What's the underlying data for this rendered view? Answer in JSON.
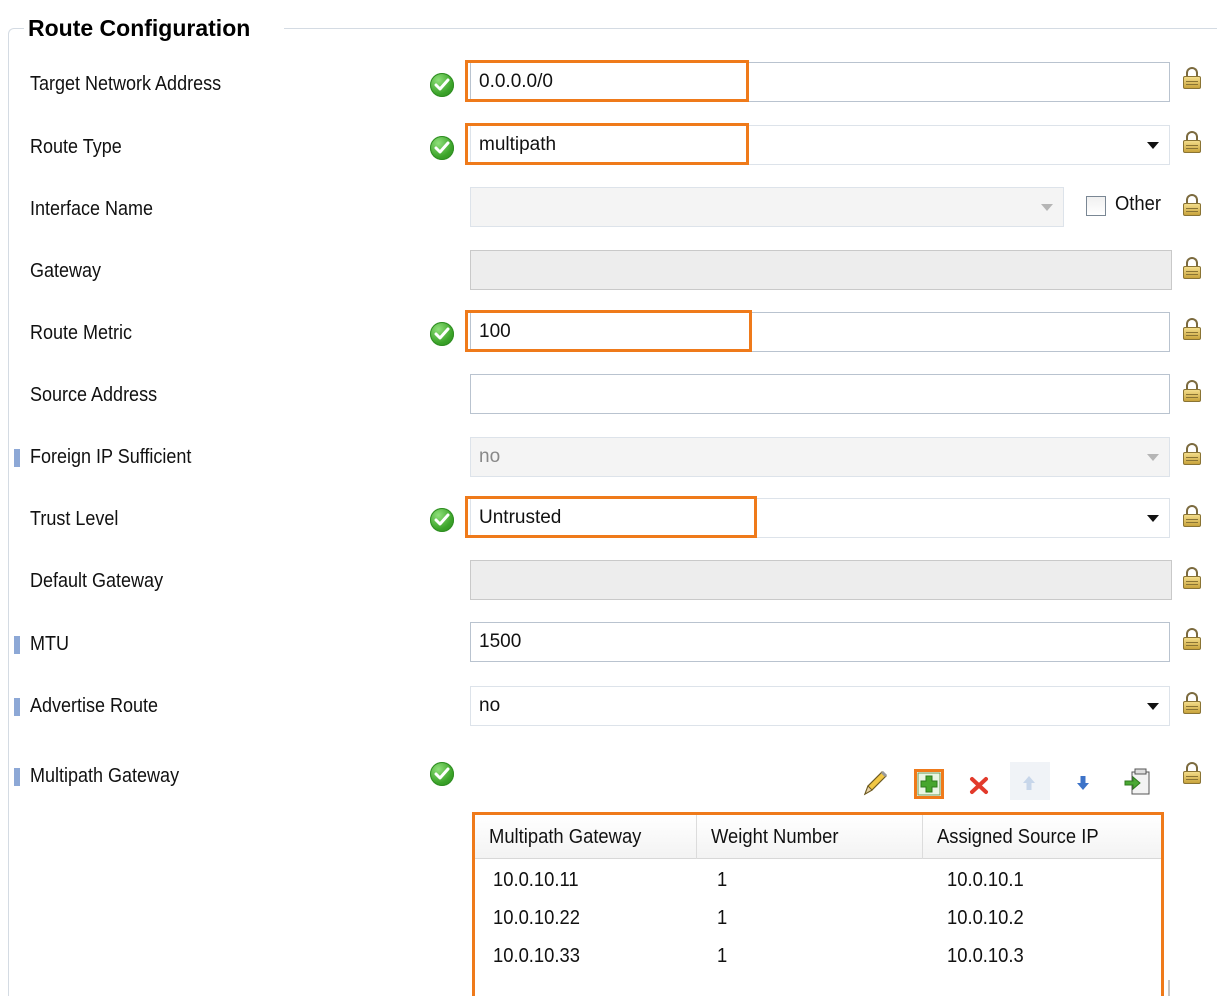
{
  "group": {
    "title": "Route Configuration"
  },
  "fields": {
    "target_network": {
      "label": "Target Network Address",
      "value": "0.0.0.0/0"
    },
    "route_type": {
      "label": "Route Type",
      "value": "multipath"
    },
    "interface_name": {
      "label": "Interface Name",
      "value": "",
      "other_label": "Other"
    },
    "gateway": {
      "label": "Gateway",
      "value": ""
    },
    "route_metric": {
      "label": "Route Metric",
      "value": "100"
    },
    "source_address": {
      "label": "Source Address",
      "value": ""
    },
    "foreign_ip": {
      "label": "Foreign IP Sufficient",
      "value": "no"
    },
    "trust_level": {
      "label": "Trust Level",
      "value": "Untrusted"
    },
    "default_gateway": {
      "label": "Default Gateway",
      "value": ""
    },
    "mtu": {
      "label": "MTU",
      "value": "1500"
    },
    "advertise_route": {
      "label": "Advertise Route",
      "value": "no"
    },
    "multipath_gateway": {
      "label": "Multipath Gateway"
    }
  },
  "toolbar": {
    "icons": [
      "edit-icon",
      "add-icon",
      "delete-icon",
      "move-up-icon",
      "move-down-icon",
      "import-icon"
    ]
  },
  "table": {
    "columns": [
      "Multipath Gateway",
      "Weight Number",
      "Assigned Source IP"
    ],
    "rows": [
      [
        "10.0.10.11",
        "1",
        "10.0.10.1"
      ],
      [
        "10.0.10.22",
        "1",
        "10.0.10.2"
      ],
      [
        "10.0.10.33",
        "1",
        "10.0.10.3"
      ]
    ]
  },
  "colors": {
    "highlight": "#ef7a1a",
    "marker": "#8da8d6",
    "valid": "#3ca42a"
  }
}
